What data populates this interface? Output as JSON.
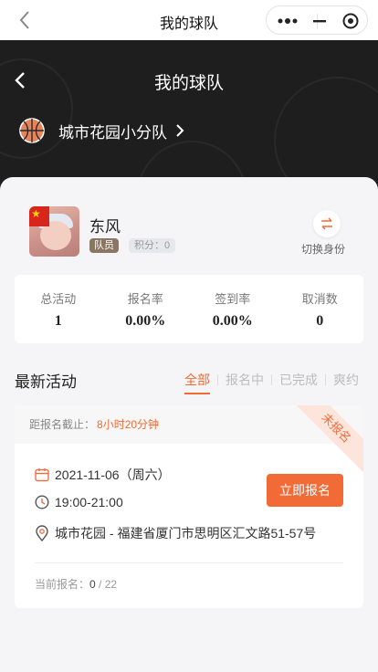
{
  "wx_bar": {
    "title": "我的球队"
  },
  "header": {
    "title": "我的球队",
    "team_name": "城市花园小分队"
  },
  "profile": {
    "name": "东风",
    "role": "队员",
    "points_label": "积分：",
    "points": "0",
    "switch_label": "切换身份"
  },
  "stats": [
    {
      "label": "总活动",
      "value": "1"
    },
    {
      "label": "报名率",
      "value": "0.00%"
    },
    {
      "label": "签到率",
      "value": "0.00%"
    },
    {
      "label": "取消数",
      "value": "0"
    }
  ],
  "activities": {
    "title": "最新活动",
    "filters": [
      "全部",
      "报名中",
      "已完成",
      "爽约"
    ],
    "active_filter": "全部"
  },
  "activity": {
    "deadline_label": "距报名截止：",
    "deadline_value": "8小时20分钟",
    "ribbon": "未报名",
    "date": "2021-11-06（周六）",
    "time": "19:00-21:00",
    "location": "城市花园 - 福建省厦门市思明区汇文路51-57号",
    "button_label": "立即报名",
    "current_label": "当前报名：",
    "current_count": "0",
    "capacity": "22"
  },
  "colors": {
    "accent": "#f06a34",
    "header_bg": "#1e1e1e",
    "role_tag": "#8a7661"
  }
}
